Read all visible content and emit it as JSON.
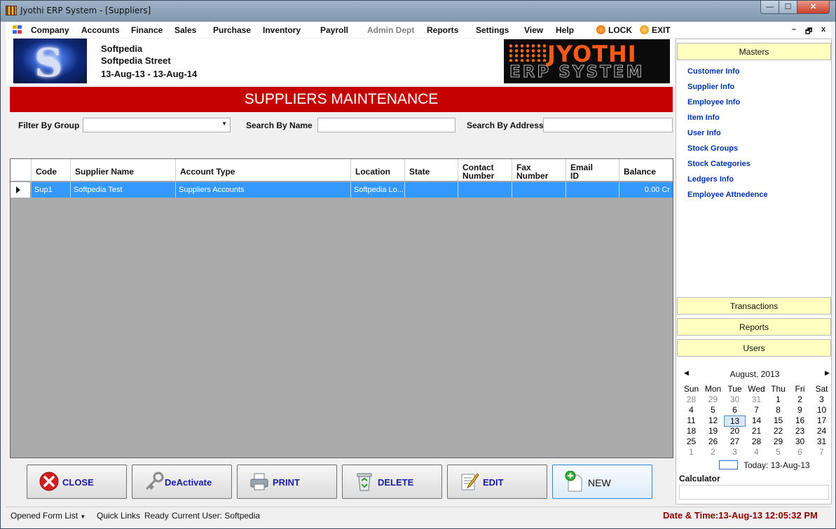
{
  "window": {
    "title": "Jyothi ERP System - [Suppliers]",
    "min_glyph": "—",
    "max_glyph": "☐",
    "close_glyph": "✕"
  },
  "menu": {
    "items": [
      {
        "label": "Company",
        "enabled": true
      },
      {
        "label": "Accounts",
        "enabled": true
      },
      {
        "label": "Finance",
        "enabled": true
      },
      {
        "label": "Sales",
        "enabled": true
      },
      {
        "label": "Purchase",
        "enabled": true
      },
      {
        "label": "Inventory",
        "enabled": true
      },
      {
        "label": "Payroll",
        "enabled": true
      },
      {
        "label": "Admin Dept",
        "enabled": false
      },
      {
        "label": "Reports",
        "enabled": true
      },
      {
        "label": "Settings",
        "enabled": true
      },
      {
        "label": "View",
        "enabled": true
      },
      {
        "label": "Help",
        "enabled": true
      }
    ],
    "lock_label": "LOCK",
    "exit_label": "EXIT",
    "mdi_min": "–",
    "mdi_restore": "🗗",
    "mdi_close": "x"
  },
  "company": {
    "name": "Softpedia",
    "street": "Softpedia Street",
    "period": "13-Aug-13 - 13-Aug-14",
    "logo_letter": "S"
  },
  "brand": {
    "line1": "JYOTHI",
    "line2": "ERP SYSTEM"
  },
  "banner": "SUPPLIERS MAINTENANCE",
  "filters": {
    "group_label": "Filter By Group",
    "group_value": "",
    "name_label": "Search By Name",
    "name_value": "",
    "address_label": "Search By Address",
    "address_value": ""
  },
  "grid": {
    "columns": [
      "Code",
      "Supplier Name",
      "Account Type",
      "Location",
      "State",
      "Contact Number",
      "Fax Number",
      "Email ID",
      "Balance"
    ],
    "column_lines": [
      [
        "Code"
      ],
      [
        "Supplier Name"
      ],
      [
        "Account Type"
      ],
      [
        "Location"
      ],
      [
        "State"
      ],
      [
        "Contact",
        "Number"
      ],
      [
        "Fax",
        "Number"
      ],
      [
        "Email",
        "ID"
      ],
      [
        "Balance"
      ]
    ],
    "rows": [
      {
        "code": "Sup1",
        "supplier_name": "Softpedia Test",
        "account_type": "Suppliers Accounts",
        "location": "Softpedia Lo...",
        "state": "",
        "contact_number": "",
        "fax_number": "",
        "email_id": "",
        "balance": "0.00 Cr"
      }
    ]
  },
  "buttons": {
    "close": "CLOSE",
    "deactivate": "DeActivate",
    "print": "PRINT",
    "delete": "DELETE",
    "edit": "EDIT",
    "new": "NEW"
  },
  "status": {
    "opened_form_list": "Opened Form List",
    "quick_links": "Quick Links",
    "ready": "Ready",
    "current_user": "Current User: Softpedia",
    "datetime": "Date & Time:13-Aug-13 12:05:32 PM"
  },
  "sidebar": {
    "masters": "Masters",
    "master_links": [
      "Customer Info",
      "Supplier Info",
      "Employee Info",
      "Item Info",
      "User Info",
      "Stock Groups",
      "Stock Categories",
      "Ledgers Info",
      "Employee Attnedence"
    ],
    "transactions": "Transactions",
    "reports": "Reports",
    "users": "Users"
  },
  "calendar": {
    "month_label": "August, 2013",
    "weekdays": [
      "Sun",
      "Mon",
      "Tue",
      "Wed",
      "Thu",
      "Fri",
      "Sat"
    ],
    "weeks": [
      [
        "28",
        "29",
        "30",
        "31",
        "1",
        "2",
        "3"
      ],
      [
        "4",
        "5",
        "6",
        "7",
        "8",
        "9",
        "10"
      ],
      [
        "11",
        "12",
        "13",
        "14",
        "15",
        "16",
        "17"
      ],
      [
        "18",
        "19",
        "20",
        "21",
        "22",
        "23",
        "24"
      ],
      [
        "25",
        "26",
        "27",
        "28",
        "29",
        "30",
        "31"
      ],
      [
        "1",
        "2",
        "3",
        "4",
        "5",
        "6",
        "7"
      ]
    ],
    "selected_day": "13",
    "today_label": "Today: 13-Aug-13"
  },
  "calculator": {
    "label": "Calculator",
    "value": ""
  },
  "colors": {
    "banner": "#c40000",
    "selection": "#3399ff",
    "side_header": "#ffffc0",
    "link": "#0033aa",
    "datetime": "#8b0000"
  }
}
